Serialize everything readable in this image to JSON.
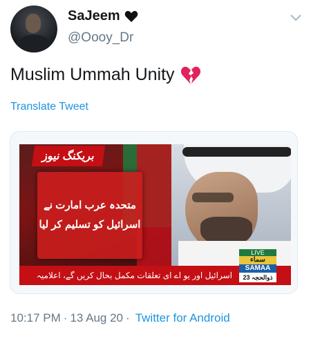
{
  "user": {
    "display_name": "SaJeem",
    "handle": "@Oooy_Dr",
    "name_emoji": "black-heart-icon"
  },
  "tweet": {
    "text": "Muslim Ummah Unity",
    "text_emoji": "broken-heart-icon",
    "translate_label": "Translate Tweet"
  },
  "media": {
    "breaking_label": "بریکنگ نیوز",
    "headline_line1": "متحدہ عرب امارت نے",
    "headline_line2": "اسرائیل کو تسلیم کر لیا",
    "ticker": "اسرائیل اور یو اے ای تعلقات مکمل بحال کریں گے، اعلامیہ",
    "live": "LIVE",
    "channel_urdu": "سماء",
    "channel": "SAMAA",
    "date": "23 ذوالحجہ"
  },
  "meta": {
    "time": "10:17 PM",
    "date": "13 Aug 20",
    "source": "Twitter for Android",
    "separator": "·"
  },
  "colors": {
    "link": "#1b95e0",
    "secondary_text": "#657786",
    "broken_heart": "#e0245e"
  }
}
